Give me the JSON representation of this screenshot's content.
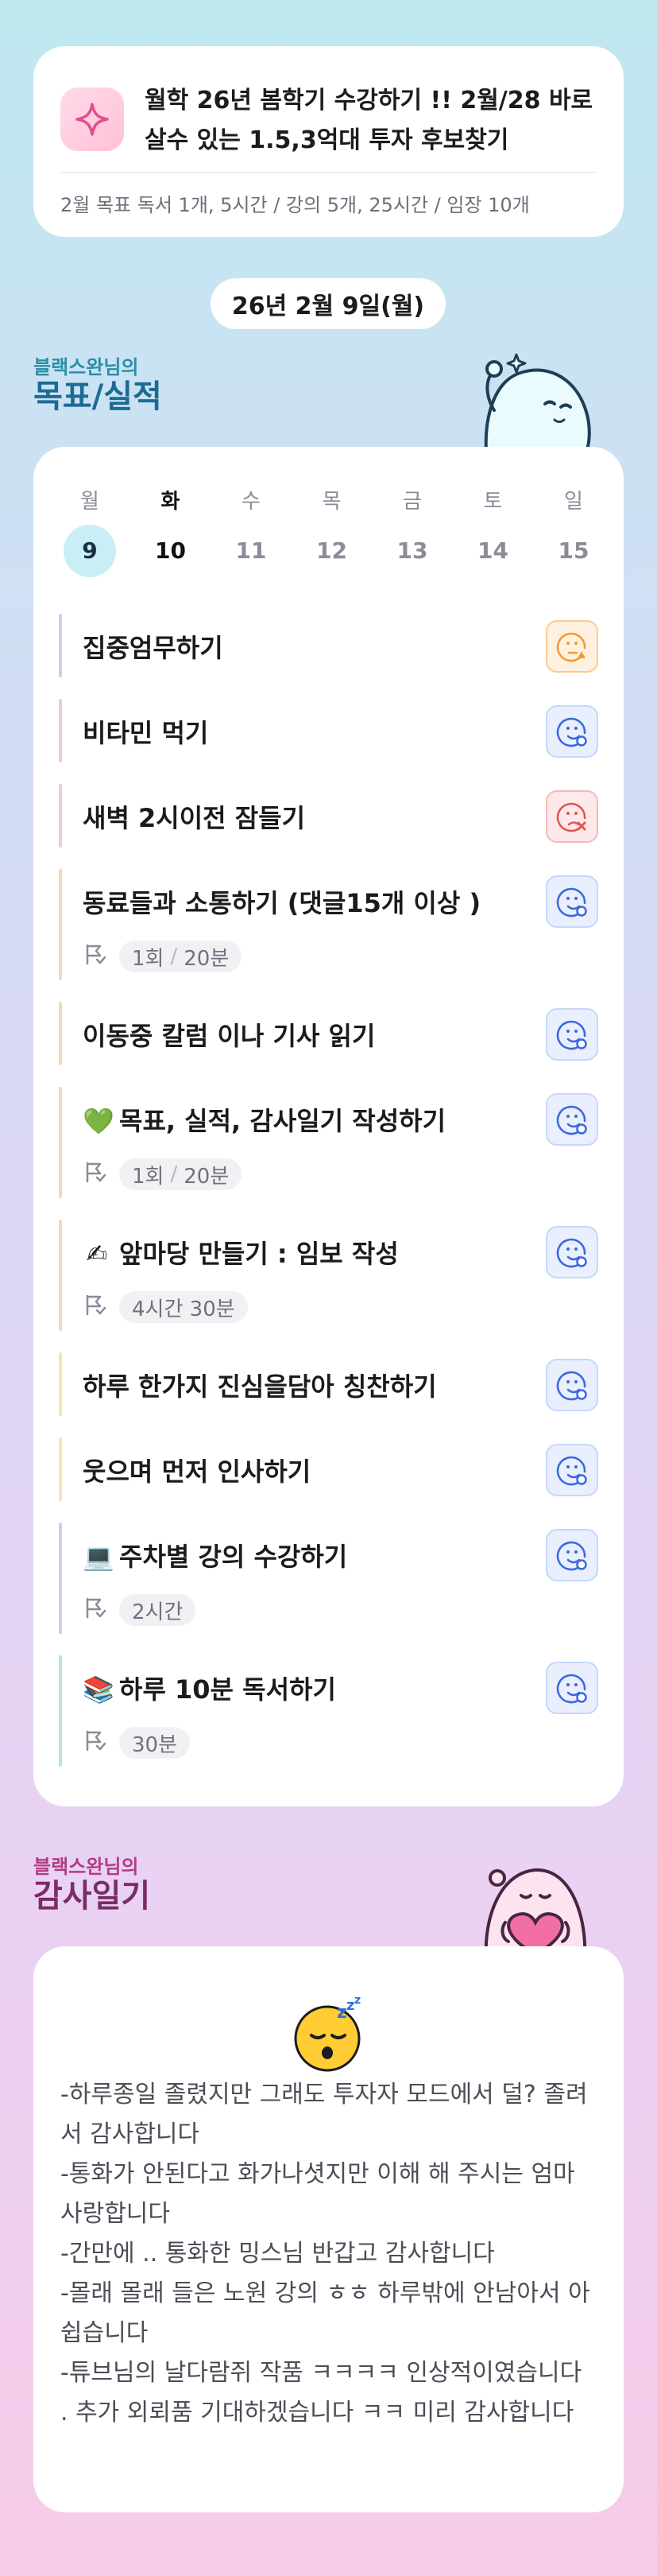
{
  "header": {
    "icon": "sparkle-icon",
    "title": "월학 26년 봄학기 수강하기 !! 2월/28 바로살수 있는 1.5,3억대 투자 후보찾기",
    "subtitle": "2월 목표  독서 1개, 5시간 / 강의 5개, 25시간 / 임장 10개"
  },
  "date_label": "26년 2월 9일(월)",
  "goals_section": {
    "small": "블랙스완님의",
    "big": "목표/실적"
  },
  "week": [
    {
      "day": "월",
      "date": "9",
      "today": true
    },
    {
      "day": "화",
      "date": "10",
      "selected": true
    },
    {
      "day": "수",
      "date": "11"
    },
    {
      "day": "목",
      "date": "12"
    },
    {
      "day": "금",
      "date": "13"
    },
    {
      "day": "토",
      "date": "14"
    },
    {
      "day": "일",
      "date": "15"
    }
  ],
  "tasks": [
    {
      "title": "집중엄무하기",
      "status": "pending",
      "bar_color": "#c8d0f5"
    },
    {
      "title": "비타민 먹기",
      "status": "done",
      "bar_color": "#f6c6dd"
    },
    {
      "title": "새벽 2시이전 잠들기",
      "status": "failed",
      "bar_color": "#f6c6dd"
    },
    {
      "title": "동료들과 소통하기 (댓글15개 이상 )",
      "status": "done",
      "bar_color": "#f9d6b4",
      "progress": {
        "count": "1회",
        "total": "20분"
      }
    },
    {
      "title": "이동중 칼럼 이나 기사 읽기",
      "status": "done",
      "bar_color": "#f9d6b4"
    },
    {
      "emoji": "💚",
      "title": "목표, 실적, 감사일기 작성하기",
      "status": "done",
      "bar_color": "#f9d6b4",
      "progress": {
        "count": "1회",
        "total": "20분"
      }
    },
    {
      "emoji": "✍",
      "title": "앞마당 만들기 : 임보 작성",
      "status": "done",
      "bar_color": "#f9d6b4",
      "progress": {
        "value": "4시간 30분"
      }
    },
    {
      "title": "하루 한가지 진심을담아 칭찬하기",
      "status": "done",
      "bar_color": "#f9e2b4"
    },
    {
      "title": "웃으며 먼저 인사하기",
      "status": "done",
      "bar_color": "#f9e2b4"
    },
    {
      "emoji": "💻",
      "title": "주차별 강의 수강하기",
      "status": "done",
      "bar_color": "#c8d0f5",
      "progress": {
        "value": "2시간"
      }
    },
    {
      "emoji": "📚",
      "title": "하루 10분 독서하기",
      "status": "done",
      "bar_color": "#b8e6d2",
      "progress": {
        "value": "30분"
      }
    }
  ],
  "diary_section": {
    "small": "블랙스완님의",
    "big": "감사일기"
  },
  "diary": {
    "mood_icon": "sleeping-face-icon",
    "text": "-하루종일  졸렸지만  그래도  투자자 모드에서 덜? 졸려서 감사합니다\n-통화가 안된다고  화가나셧지만  이해 해 주시는 엄마 사랑합니다\n-간만에 .. 통화한  밍스님 반갑고 감사합니다\n-몰래 몰래 들은 노원 강의  ㅎㅎ  하루밖에 안남아서 아쉽습니다\n-튜브님의  날다람쥐  작품 ㅋㅋㅋㅋ   인상적이였습니다   . 추가 외뢰품  기대하겠습니다 ㅋㅋ   미리 감사합니다"
  },
  "colors": {
    "accent_blue": "#3a68e0",
    "today_circle": "#c9eef6",
    "pending_orange": "#f39a2e",
    "failed_red": "#e0554f"
  }
}
